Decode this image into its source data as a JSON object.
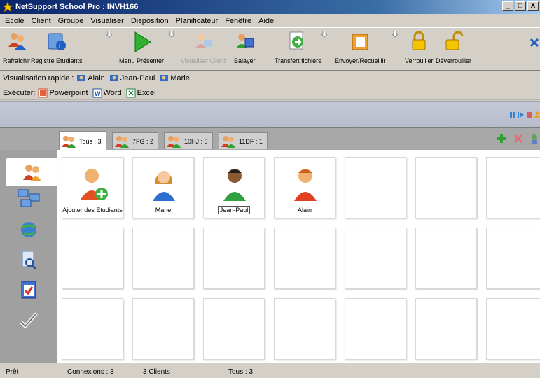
{
  "window": {
    "title": "NetSupport School Pro : INVH166",
    "controls": [
      "_",
      "□",
      "X"
    ]
  },
  "menu": [
    "Ecole",
    "Client",
    "Groupe",
    "Visualiser",
    "Disposition",
    "Planificateur",
    "Fenêtre",
    "Aide"
  ],
  "toolbar": {
    "refresh": "Rafraîchir",
    "register": "Registre Etudiants",
    "present": "Menu Présenter",
    "view_client": "Visualiser Client",
    "scan": "Balayer",
    "file_transfer": "Transfert fichiers",
    "send_collect": "Envoyer/Recueillir",
    "lock": "Verrouiller",
    "unlock": "Déverrouiller"
  },
  "quick_view": {
    "label": "Visualisation rapide :",
    "items": [
      "Alain",
      "Jean-Paul",
      "Marie"
    ]
  },
  "execute": {
    "label": "Exécuter:",
    "items": [
      "Powerpoint",
      "Word",
      "Excel"
    ]
  },
  "tabs": [
    {
      "label": "Tous : 3",
      "active": true
    },
    {
      "label": "7FG : 2",
      "active": false
    },
    {
      "label": "10HJ : 0",
      "active": false
    },
    {
      "label": "11DF : 1",
      "active": false
    }
  ],
  "cards": [
    {
      "label": "Ajouter des Etudiants",
      "icon": "add-student-icon"
    },
    {
      "label": "Marie",
      "icon": "female-student-icon"
    },
    {
      "label": "Jean-Paul",
      "icon": "male-student-dark-icon",
      "selected": true
    },
    {
      "label": "Alain",
      "icon": "male-student-icon"
    }
  ],
  "status": {
    "state": "Prêt",
    "connections": "Connexions : 3",
    "clients": "3 Clients",
    "all": "Tous : 3"
  },
  "colors": {
    "title_bar": "#0a246a",
    "band": "#c4c8d6",
    "tabs_bar": "#a8a8a8",
    "sidebar": "#a0a0a0"
  }
}
